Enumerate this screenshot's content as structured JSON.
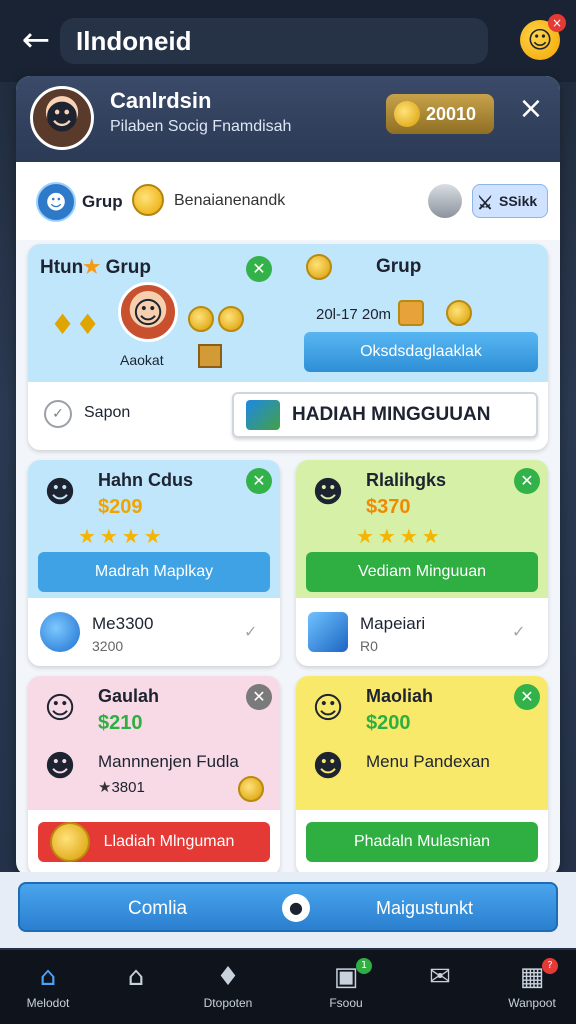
{
  "header": {
    "title": "Ilndoneid",
    "back_icon": "arrow-left-icon",
    "avatar_badge": "×"
  },
  "profile": {
    "name": "Canlrdsin",
    "subtitle": "Pilaben Socig Fnamdisah",
    "coins": "20010",
    "close": "×"
  },
  "group_row": {
    "label": "Grup",
    "text": "Benaianenandk",
    "stick_label": "SSikk"
  },
  "featured": {
    "left_title": "Htun",
    "left_group": "Grup",
    "left_char_label": "Aaokat",
    "right_title": "Grup",
    "right_date": "20l-17 20m",
    "right_button": "Oksdsdaglaaklak",
    "sapon_label": "Sapon",
    "hadiah_button": "HADIAH MINGGUUAN"
  },
  "cards": [
    {
      "title": "Hahn Cdus",
      "price": "$209",
      "button": "Madrah Maplkay",
      "bottom_title": "Me3300",
      "bottom_sub": "3200",
      "theme": "#bfe6fb",
      "btn_color": "#3ea2e4",
      "price_color": "#f0a400"
    },
    {
      "title": "Rlalihgks",
      "price": "$370",
      "button": "Vediam Minguuan",
      "bottom_title": "Mapeiari",
      "bottom_sub": "R0",
      "theme": "#d6f0a8",
      "btn_color": "#2fae42",
      "price_color": "#f08a00"
    },
    {
      "title": "Gaulah",
      "price": "$210",
      "sub_title": "Mannnenjen Fudla",
      "sub_value": "3801",
      "button": "Lladiah Mlnguman",
      "theme": "#f8d9e6",
      "btn_color": "#e53935",
      "price_color": "#2fae42"
    },
    {
      "title": "Maoliah",
      "price": "$200",
      "sub_title": "Menu Pandexan",
      "button": "Phadaln Mulasnian",
      "theme": "#f8e96a",
      "btn_color": "#2fae42",
      "price_color": "#2fae42"
    }
  ],
  "bottom_action": {
    "left": "Comlia",
    "right": "Maigustunkt"
  },
  "nav": [
    {
      "label": "Melodot",
      "badge": ""
    },
    {
      "label": "",
      "badge": ""
    },
    {
      "label": "Dtopoten",
      "badge": ""
    },
    {
      "label": "Fsoou",
      "badge": "1"
    },
    {
      "label": "",
      "badge": ""
    },
    {
      "label": "Wanpoot",
      "badge": "?"
    }
  ]
}
